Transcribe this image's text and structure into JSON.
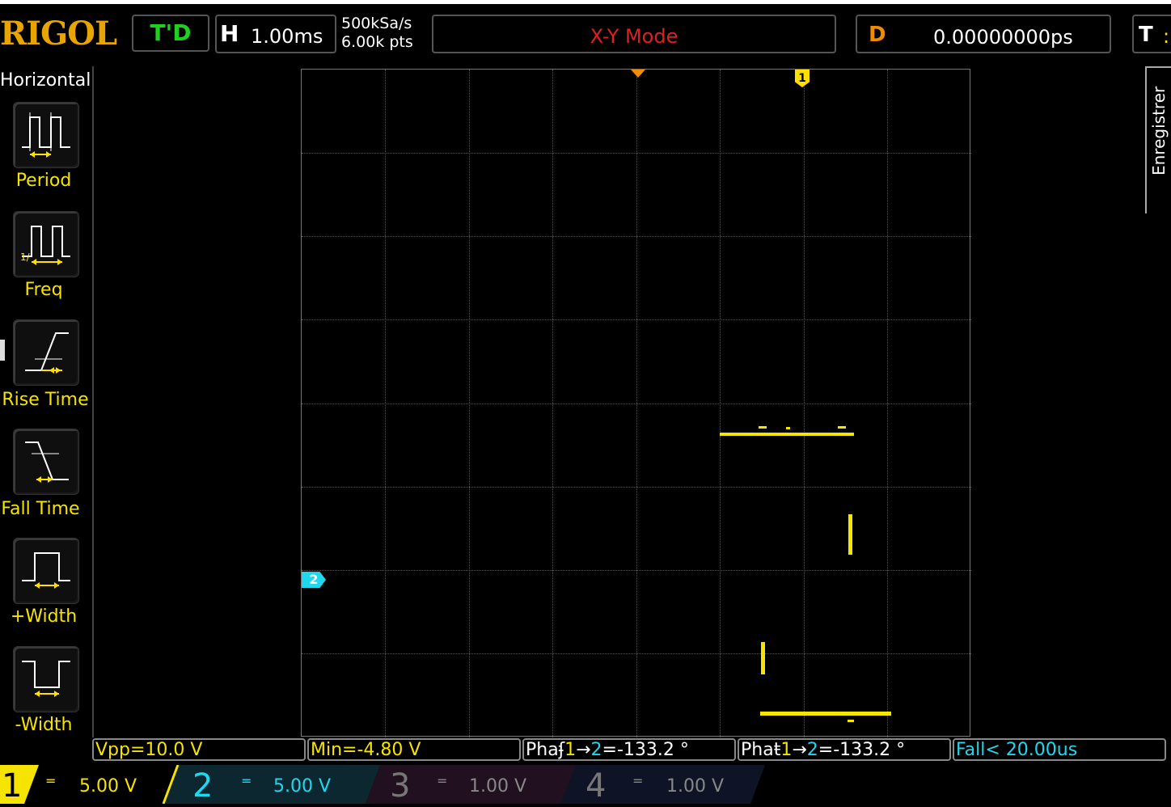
{
  "topbar": {
    "brand": "RIGOL",
    "trigger_status": "T'D",
    "horizontal_label": "H",
    "timebase": "1.00ms",
    "sample_rate": "500kSa/s",
    "memory_depth": "6.00k pts",
    "mode": "X-Y Mode",
    "delay_label": "D",
    "delay_value": "0.00000000ps",
    "trigger_label": "T",
    "trigger_extra": ":"
  },
  "left_menu": {
    "title": "Horizontal",
    "items": [
      {
        "label": "Period",
        "icon": "period-icon"
      },
      {
        "label": "Freq",
        "icon": "frequency-icon"
      },
      {
        "label": "Rise Time",
        "icon": "rise-time-icon"
      },
      {
        "label": "Fall Time",
        "icon": "fall-time-icon"
      },
      {
        "label": "+Width",
        "icon": "positive-width-icon"
      },
      {
        "label": "-Width",
        "icon": "negative-width-icon"
      }
    ]
  },
  "right_menu": {
    "label": "Enregistrer"
  },
  "screen": {
    "ch1_marker": "1",
    "ch2_marker": "2"
  },
  "measurements": [
    {
      "text": "Vpp=10.0 V",
      "color": "#f5e400"
    },
    {
      "text": "Min=-4.80 V",
      "color": "#f5e400"
    },
    {
      "prefix": "Pha",
      "glyph": "ʄ",
      "src": "1",
      "arrow": "→",
      "dst": "2",
      "value": "=-133.2 °"
    },
    {
      "prefix": "Pha",
      "glyph": "ŧ",
      "src": "1",
      "arrow": "→",
      "dst": "2",
      "value": "=-133.2 °"
    },
    {
      "text": "Fall< 20.00us",
      "color": "#20d8ee"
    }
  ],
  "channels": [
    {
      "num": "1",
      "coupling": "=",
      "scale": "5.00 V",
      "color": "#f5e400",
      "active": true
    },
    {
      "num": "2",
      "coupling": "=",
      "scale": "5.00 V",
      "color": "#20d8ee",
      "active": true
    },
    {
      "num": "3",
      "coupling": "=",
      "scale": "1.00 V",
      "color": "#888888",
      "active": false
    },
    {
      "num": "4",
      "coupling": "=",
      "scale": "1.00 V",
      "color": "#888888",
      "active": false
    }
  ],
  "colors": {
    "ch1": "#f5e400",
    "ch2": "#20d8ee",
    "brand": "#e8a400",
    "mode_text": "#e02020",
    "trigger_status": "#20d020"
  }
}
